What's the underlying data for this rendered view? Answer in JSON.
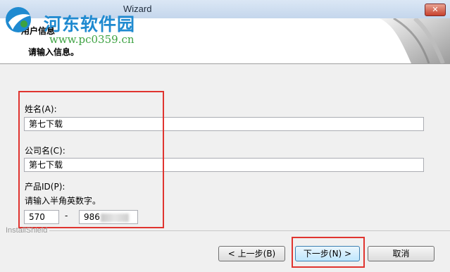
{
  "window": {
    "title": "Wizard",
    "close_label": "✕"
  },
  "watermark": {
    "title": "河东软件园",
    "url": "www.pc0359.cn"
  },
  "header": {
    "title": "用户信息",
    "subtitle": "请输入信息。"
  },
  "form": {
    "name_label": "姓名(A):",
    "name_value": "第七下载",
    "company_label": "公司名(C):",
    "company_value": "第七下载",
    "product_id_label": "产品ID(P):",
    "product_id_hint": "请输入半角英数字。",
    "product_id_part1": "570",
    "product_id_sep": "-",
    "product_id_part2": "986"
  },
  "footer": {
    "brand": "InstallShield",
    "back_label": "< 上一步(B)",
    "next_label": "下一步(N) >",
    "cancel_label": "取消"
  },
  "colors": {
    "highlight": "#e0342f",
    "watermark_blue": "#1f8ad0",
    "watermark_green": "#3da242"
  }
}
